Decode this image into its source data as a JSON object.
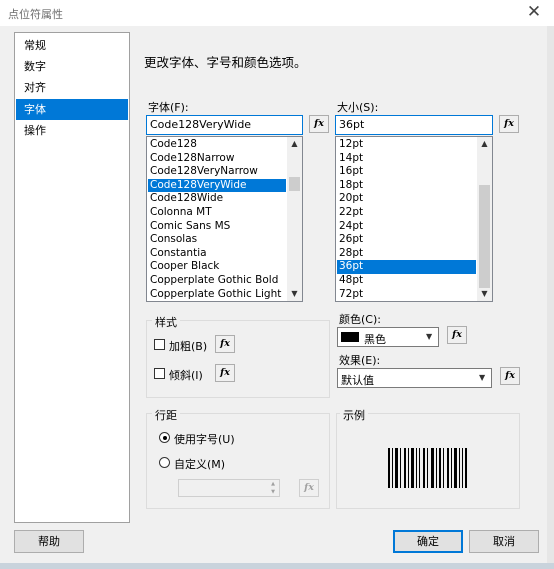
{
  "window": {
    "title": "点位符属性",
    "close_glyph": "✕"
  },
  "nav": {
    "items": [
      "常规",
      "数字",
      "对齐",
      "字体",
      "操作"
    ],
    "selected_index": 3
  },
  "main": {
    "heading": "更改字体、字号和颜色选项。"
  },
  "font": {
    "label": "字体(F):",
    "value": "Code128VeryWide",
    "options": [
      "Code128",
      "Code128Narrow",
      "Code128VeryNarrow",
      "Code128VeryWide",
      "Code128Wide",
      "Colonna MT",
      "Comic Sans MS",
      "Consolas",
      "Constantia",
      "Cooper Black",
      "Copperplate Gothic Bold",
      "Copperplate Gothic Light"
    ],
    "selected_index": 3
  },
  "size": {
    "label": "大小(S):",
    "value": "36pt",
    "options": [
      "12pt",
      "14pt",
      "16pt",
      "18pt",
      "20pt",
      "22pt",
      "24pt",
      "26pt",
      "28pt",
      "36pt",
      "48pt",
      "72pt"
    ],
    "selected_index": 9
  },
  "style": {
    "group_label": "样式",
    "bold_label": "加粗(B)",
    "italic_label": "倾斜(I)",
    "bold_checked": false,
    "italic_checked": false
  },
  "color": {
    "label": "颜色(C):",
    "value": "黑色",
    "swatch": "#000000"
  },
  "effect": {
    "label": "效果(E):",
    "value": "默认值"
  },
  "spacing": {
    "group_label": "行距",
    "use_font_label": "使用字号(U)",
    "custom_label": "自定义(M)",
    "selected": "use_font"
  },
  "preview": {
    "group_label": "示例"
  },
  "fx_label": "fx",
  "buttons": {
    "help": "帮助",
    "ok": "确定",
    "cancel": "取消"
  },
  "colors": {
    "accent": "#0078d7",
    "dialog_bg": "#f0f0f0"
  }
}
